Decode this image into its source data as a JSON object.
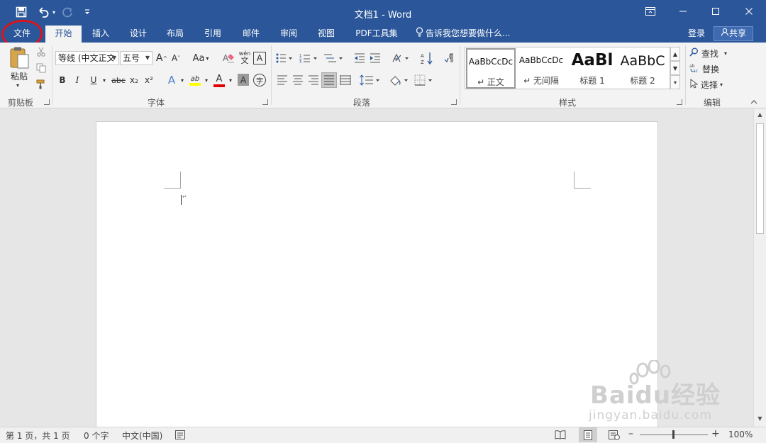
{
  "window": {
    "title": "文档1 - Word",
    "accent_color": "#2b579a",
    "highlight_color": "#d9141a"
  },
  "quick_access": {
    "save_icon": "save-icon",
    "undo_icon": "undo-icon",
    "redo_icon": "redo-icon",
    "customize_icon": "customize-qat-icon"
  },
  "tabs": [
    "文件",
    "开始",
    "插入",
    "设计",
    "布局",
    "引用",
    "邮件",
    "审阅",
    "视图",
    "PDF工具集"
  ],
  "active_tab": "开始",
  "tell_me": "告诉我您想要做什么...",
  "account": {
    "login": "登录",
    "share": "共享"
  },
  "ribbon": {
    "clipboard": {
      "label": "剪贴板",
      "paste": "粘贴"
    },
    "font": {
      "label": "字体",
      "font_name": "等线 (中文正文",
      "font_size": "五号",
      "bold": "B",
      "italic": "I",
      "underline": "U",
      "strike": "abc",
      "subscript": "x₂",
      "superscript": "x²",
      "change_case": "Aa",
      "grow": "A",
      "shrink": "A",
      "clear_format_label": "A",
      "phonetic_top": "wén",
      "phonetic_bottom": "文",
      "border_char": "A",
      "text_effect": "A",
      "highlight": "ab",
      "font_color": "A",
      "char_shading": "A",
      "enclose": "字"
    },
    "paragraph": {
      "label": "段落"
    },
    "styles": {
      "label": "样式",
      "items": [
        {
          "sample": "AaBbCcDc",
          "name": "↵ 正文"
        },
        {
          "sample": "AaBbCcDc",
          "name": "↵ 无间隔"
        },
        {
          "sample": "AaBl",
          "name": "标题 1"
        },
        {
          "sample": "AaBbC",
          "name": "标题 2"
        }
      ]
    },
    "editing": {
      "label": "编辑",
      "find": "查找",
      "replace": "替换",
      "select": "选择"
    }
  },
  "statusbar": {
    "page": "第 1 页，共 1 页",
    "words": "0 个字",
    "language": "中文(中国)",
    "zoom": "100%"
  },
  "watermark": {
    "brand": "Baidu经验",
    "url": "jingyan.baidu.com"
  }
}
